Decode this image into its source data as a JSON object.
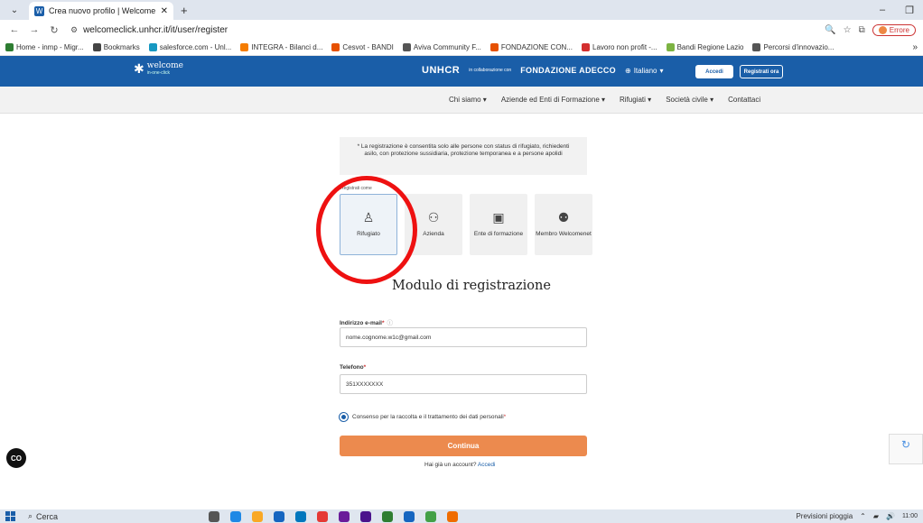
{
  "browser": {
    "tab_title": "Crea nuovo profilo | Welcome",
    "url": "welcomeclick.unhcr.it/it/user/register",
    "profile_status": "Errore",
    "bookmarks": [
      {
        "label": "Home - inmp - Migr...",
        "color": "#2e7d32"
      },
      {
        "label": "Bookmarks",
        "color": "#444444"
      },
      {
        "label": "salesforce.com - Unl...",
        "color": "#1798c1"
      },
      {
        "label": "INTEGRA - Bilanci d...",
        "color": "#f57c00"
      },
      {
        "label": "Cesvot - BANDI",
        "color": "#e65100"
      },
      {
        "label": "Aviva Community F...",
        "color": "#555555"
      },
      {
        "label": "FONDAZIONE CON...",
        "color": "#e65100"
      },
      {
        "label": "Lavoro non profit -...",
        "color": "#d32f2f"
      },
      {
        "label": "Bandi Regione Lazio",
        "color": "#7cb342"
      },
      {
        "label": "Percorsi d'innovazio...",
        "color": "#555555"
      }
    ]
  },
  "header": {
    "logo_text": "welcome",
    "logo_sub": "in-one-click",
    "partner1": "UNHCR",
    "collab": "in collaborazione con",
    "partner2": "FONDAZIONE ADECCO",
    "language": "Italiano",
    "login_label": "Accedi",
    "register_label": "Registrati ora"
  },
  "nav": [
    "Chi siamo",
    "Aziende ed Enti di Formazione",
    "Rifugiati",
    "Società civile",
    "Contattaci"
  ],
  "notice": "* La registrazione è consentita solo alle persone con status di rifugiato, richiedenti asilo, con protezione sussidiaria, protezione temporanea e a persone apolidi",
  "register_as": "Registrati come",
  "roles": [
    {
      "label": "Rifugiato",
      "icon": "person-icon"
    },
    {
      "label": "Azienda",
      "icon": "building-icon"
    },
    {
      "label": "Ente di formazione",
      "icon": "school-icon"
    },
    {
      "label": "Membro Welcomenet",
      "icon": "group-icon"
    }
  ],
  "form": {
    "title": "Modulo di registrazione",
    "email_label": "Indirizzo e-mail",
    "email_value": "nome.cognome.w1c@gmail.com",
    "phone_label": "Telefono",
    "phone_value": "351XXXXXXX",
    "consent_label": "Consenso per la raccolta e il trattamento dei dati personali",
    "continue_label": "Continua",
    "have_account": "Hai già un account?",
    "login_link": "Accedi"
  },
  "taskbar": {
    "search_placeholder": "Cerca",
    "weather": "Previsioni pioggia",
    "time": "11:00"
  }
}
